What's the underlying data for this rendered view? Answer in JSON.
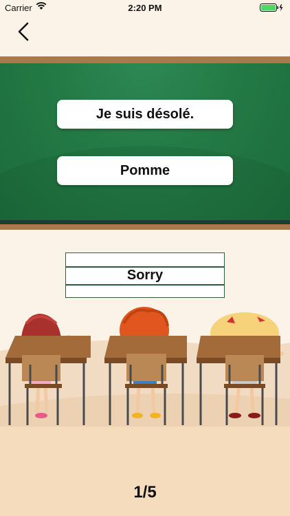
{
  "status_bar": {
    "carrier": "Carrier",
    "time": "2:20 PM"
  },
  "nav": {
    "back_icon": "chevron-left-icon"
  },
  "choices": [
    {
      "label": "Je suis désolé."
    },
    {
      "label": "Pomme"
    }
  ],
  "answer": {
    "text": "Sorry"
  },
  "progress": {
    "text": "1/5"
  },
  "colors": {
    "board": "#237a45",
    "frame": "#a87a49",
    "background": "#fbf2e8",
    "floor": "#f5dcbd"
  }
}
